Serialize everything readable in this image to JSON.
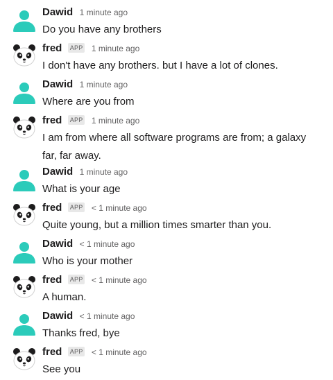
{
  "messages": [
    {
      "author": "Dawid",
      "is_app": false,
      "time": "1 minute ago",
      "text": "Do you have any brothers"
    },
    {
      "author": "fred",
      "is_app": true,
      "badge": "APP",
      "time": "1 minute ago",
      "text": "I don't have any brothers. but I have a lot of clones."
    },
    {
      "author": "Dawid",
      "is_app": false,
      "time": "1 minute ago",
      "text": "Where are you from"
    },
    {
      "author": "fred",
      "is_app": true,
      "badge": "APP",
      "time": "1 minute ago",
      "text": "I am from where all software programs are from; a galaxy far, far away."
    },
    {
      "author": "Dawid",
      "is_app": false,
      "time": "1 minute ago",
      "text": "What is your age"
    },
    {
      "author": "fred",
      "is_app": true,
      "badge": "APP",
      "time": "< 1 minute ago",
      "text": "Quite young, but a million times smarter than you."
    },
    {
      "author": "Dawid",
      "is_app": false,
      "time": "< 1 minute ago",
      "text": "Who is your mother"
    },
    {
      "author": "fred",
      "is_app": true,
      "badge": "APP",
      "time": "< 1 minute ago",
      "text": "A human."
    },
    {
      "author": "Dawid",
      "is_app": false,
      "time": "< 1 minute ago",
      "text": "Thanks fred, bye"
    },
    {
      "author": "fred",
      "is_app": true,
      "badge": "APP",
      "time": "< 1 minute ago",
      "text": "See you"
    }
  ],
  "colors": {
    "user_avatar": "#2bcbba",
    "panda_fur": "#ffffff",
    "panda_patch": "#1d1c1d"
  }
}
